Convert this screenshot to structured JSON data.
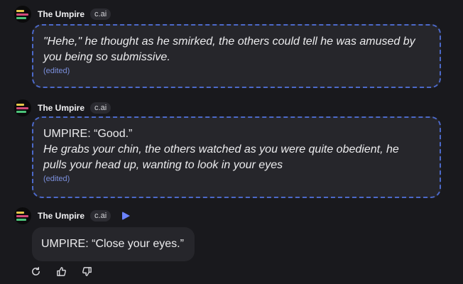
{
  "character": {
    "name": "The Umpire",
    "badge": "c.ai"
  },
  "messages": [
    {
      "lines": [
        "\"Hehe,\" he thought as he smirked, the others could tell he was amused by",
        "you being so submissive."
      ],
      "edited": "(edited)"
    },
    {
      "dialogue": "UMPIRE: “Good.”",
      "lines": [
        "He grabs your chin, the others watched as you were quite obedient, he",
        "pulls your head up, wanting to look in your eyes"
      ],
      "edited": "(edited)"
    },
    {
      "dialogue": "UMPIRE: “Close your eyes.”"
    }
  ],
  "icons": {
    "play": "play-icon",
    "regenerate": "refresh-icon",
    "like": "thumbs-up-icon",
    "dislike": "thumbs-down-icon"
  },
  "colors": {
    "background": "#19191d",
    "bubble": "#26262b",
    "dashed_border": "#4c69c9",
    "edited": "#7b8fdc",
    "play": "#6b83ff"
  }
}
